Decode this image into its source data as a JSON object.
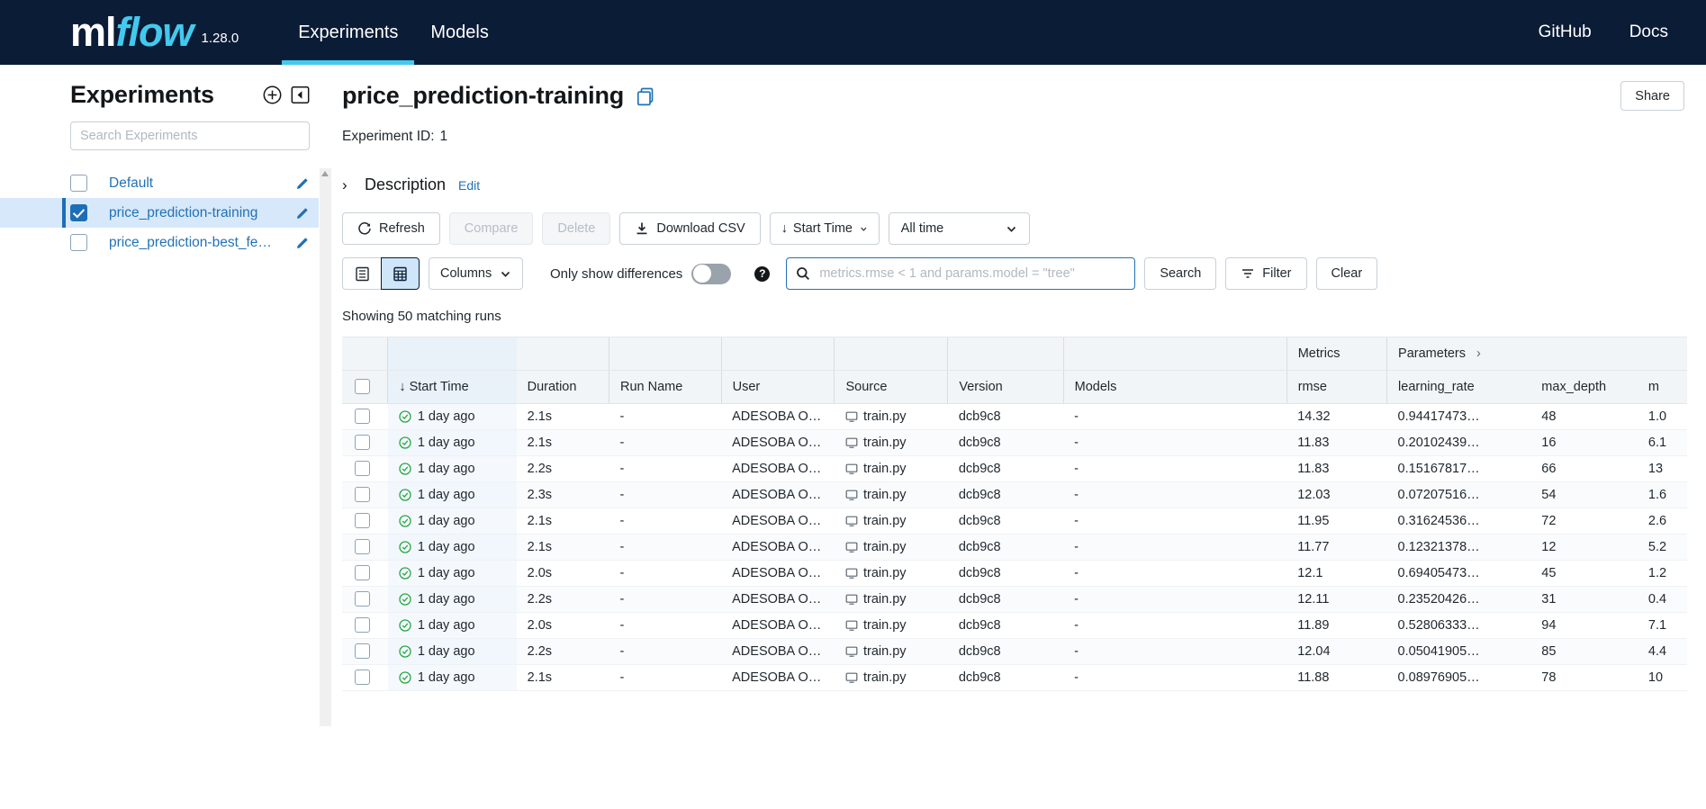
{
  "navbar": {
    "logo_ml": "ml",
    "logo_flow": "flow",
    "version": "1.28.0",
    "links": [
      {
        "label": "Experiments",
        "active": true
      },
      {
        "label": "Models",
        "active": false
      }
    ],
    "right_links": [
      {
        "label": "GitHub"
      },
      {
        "label": "Docs"
      }
    ]
  },
  "sidebar": {
    "title": "Experiments",
    "new_experiment_icon": "plus-circle-icon",
    "collapse_icon": "collapse-panel-icon",
    "search_placeholder": "Search Experiments",
    "search_value": "",
    "items": [
      {
        "label": "Default",
        "checked": false
      },
      {
        "label": "price_prediction-training",
        "checked": true
      },
      {
        "label": "price_prediction-best_fe…",
        "checked": false
      }
    ]
  },
  "header": {
    "title": "price_prediction-training",
    "copy_icon": "copy-icon",
    "share_label": "Share",
    "experiment_id_label": "Experiment ID:",
    "experiment_id_value": "1"
  },
  "description": {
    "chevron": "›",
    "label": "Description",
    "edit_label": "Edit"
  },
  "toolbar": {
    "refresh_label": "Refresh",
    "compare_label": "Compare",
    "delete_label": "Delete",
    "download_label": "Download CSV",
    "start_time_label": "Start Time",
    "time_range_label": "All time"
  },
  "toolbar2": {
    "list_view_icon": "list-view-icon",
    "grid_view_icon": "grid-view-icon",
    "columns_label": "Columns",
    "only_differences_label": "Only show differences",
    "only_differences_on": false,
    "help_icon": "help-icon",
    "search_placeholder": "metrics.rmse < 1 and params.model = \"tree\"",
    "search_value": "",
    "search_label": "Search",
    "filter_label": "Filter",
    "clear_label": "Clear"
  },
  "results": {
    "showing_text": "Showing 50 matching runs"
  },
  "table": {
    "group_headers": {
      "metrics": "Metrics",
      "parameters": "Parameters",
      "parameters_chevron": "›"
    },
    "columns": [
      "Start Time",
      "Duration",
      "Run Name",
      "User",
      "Source",
      "Version",
      "Models",
      "rmse",
      "learning_rate",
      "max_depth",
      "m"
    ],
    "sort_indicator": "↓",
    "rows": [
      {
        "start_time": "1 day ago",
        "duration": "2.1s",
        "run_name": "-",
        "user": "ADESOBA O…",
        "source": "train.py",
        "version": "dcb9c8",
        "models": "-",
        "rmse": "14.32",
        "learning_rate": "0.94417473…",
        "max_depth": "48",
        "m": "1.0"
      },
      {
        "start_time": "1 day ago",
        "duration": "2.1s",
        "run_name": "-",
        "user": "ADESOBA O…",
        "source": "train.py",
        "version": "dcb9c8",
        "models": "-",
        "rmse": "11.83",
        "learning_rate": "0.20102439…",
        "max_depth": "16",
        "m": "6.1"
      },
      {
        "start_time": "1 day ago",
        "duration": "2.2s",
        "run_name": "-",
        "user": "ADESOBA O…",
        "source": "train.py",
        "version": "dcb9c8",
        "models": "-",
        "rmse": "11.83",
        "learning_rate": "0.15167817…",
        "max_depth": "66",
        "m": "13"
      },
      {
        "start_time": "1 day ago",
        "duration": "2.3s",
        "run_name": "-",
        "user": "ADESOBA O…",
        "source": "train.py",
        "version": "dcb9c8",
        "models": "-",
        "rmse": "12.03",
        "learning_rate": "0.07207516…",
        "max_depth": "54",
        "m": "1.6"
      },
      {
        "start_time": "1 day ago",
        "duration": "2.1s",
        "run_name": "-",
        "user": "ADESOBA O…",
        "source": "train.py",
        "version": "dcb9c8",
        "models": "-",
        "rmse": "11.95",
        "learning_rate": "0.31624536…",
        "max_depth": "72",
        "m": "2.6"
      },
      {
        "start_time": "1 day ago",
        "duration": "2.1s",
        "run_name": "-",
        "user": "ADESOBA O…",
        "source": "train.py",
        "version": "dcb9c8",
        "models": "-",
        "rmse": "11.77",
        "learning_rate": "0.12321378…",
        "max_depth": "12",
        "m": "5.2"
      },
      {
        "start_time": "1 day ago",
        "duration": "2.0s",
        "run_name": "-",
        "user": "ADESOBA O…",
        "source": "train.py",
        "version": "dcb9c8",
        "models": "-",
        "rmse": "12.1",
        "learning_rate": "0.69405473…",
        "max_depth": "45",
        "m": "1.2"
      },
      {
        "start_time": "1 day ago",
        "duration": "2.2s",
        "run_name": "-",
        "user": "ADESOBA O…",
        "source": "train.py",
        "version": "dcb9c8",
        "models": "-",
        "rmse": "12.11",
        "learning_rate": "0.23520426…",
        "max_depth": "31",
        "m": "0.4"
      },
      {
        "start_time": "1 day ago",
        "duration": "2.0s",
        "run_name": "-",
        "user": "ADESOBA O…",
        "source": "train.py",
        "version": "dcb9c8",
        "models": "-",
        "rmse": "11.89",
        "learning_rate": "0.52806333…",
        "max_depth": "94",
        "m": "7.1"
      },
      {
        "start_time": "1 day ago",
        "duration": "2.2s",
        "run_name": "-",
        "user": "ADESOBA O…",
        "source": "train.py",
        "version": "dcb9c8",
        "models": "-",
        "rmse": "12.04",
        "learning_rate": "0.05041905…",
        "max_depth": "85",
        "m": "4.4"
      },
      {
        "start_time": "1 day ago",
        "duration": "2.1s",
        "run_name": "-",
        "user": "ADESOBA O…",
        "source": "train.py",
        "version": "dcb9c8",
        "models": "-",
        "rmse": "11.88",
        "learning_rate": "0.08976905…",
        "max_depth": "78",
        "m": "10"
      }
    ]
  },
  "colors": {
    "navbar_bg": "#0b1c37",
    "accent_cyan": "#43c9ed",
    "link_blue": "#2272b4",
    "selected_row_bg": "#d7e8fb",
    "success_green": "#28a745"
  }
}
